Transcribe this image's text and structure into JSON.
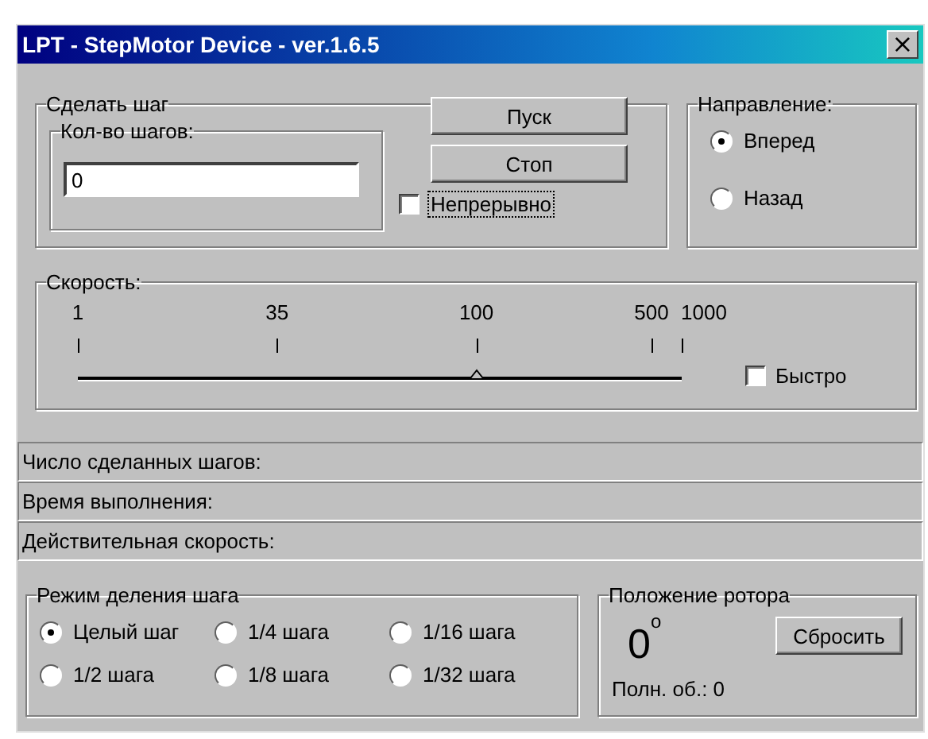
{
  "window": {
    "title": "LPT - StepMotor Device - ver.1.6.5",
    "close": "×"
  },
  "step": {
    "legend": "Сделать шаг",
    "count_legend": "Кол-во шагов:",
    "count_value": "0",
    "buttons": [
      "Пуск",
      "Стоп"
    ],
    "continuous": {
      "label": "Непрерывно",
      "checked": false
    }
  },
  "direction": {
    "legend": "Направление:",
    "options": [
      {
        "label": "Вперед",
        "selected": true
      },
      {
        "label": "Назад",
        "selected": false
      }
    ]
  },
  "speed": {
    "legend": "Скорость:",
    "ticks": [
      "1",
      "35",
      "100",
      "500",
      "1000"
    ],
    "level": 0.66,
    "fast": {
      "label": "Быстро",
      "checked": false
    }
  },
  "status": [
    "Число сделанных шагов:",
    "Время выполнения:",
    "Действительная скорость:"
  ],
  "mode": {
    "legend": "Режим деления шага",
    "options": [
      {
        "label": "Целый шаг",
        "selected": true
      },
      {
        "label": "1/4 шага",
        "selected": false
      },
      {
        "label": "1/16 шага",
        "selected": false
      },
      {
        "label": "1/2 шага",
        "selected": false
      },
      {
        "label": "1/8 шага",
        "selected": false
      },
      {
        "label": "1/32 шага",
        "selected": false
      }
    ]
  },
  "rotor": {
    "legend": "Положение ротора",
    "angle": "0",
    "degree_mark": "o",
    "reset": "Сбросить",
    "turns": "Полн. об.: 0"
  }
}
